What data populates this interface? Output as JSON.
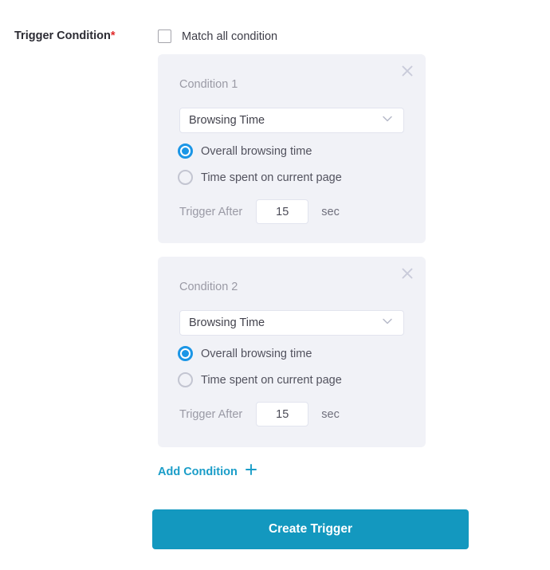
{
  "form": {
    "label": "Trigger Condition",
    "required_marker": "*",
    "match_all": {
      "label": "Match all condition",
      "checked": false
    },
    "conditions": [
      {
        "title": "Condition 1",
        "close_icon": "close-icon",
        "select": {
          "value": "Browsing Time",
          "chevron_icon": "chevron-down-icon"
        },
        "radios": [
          {
            "label": "Overall browsing time",
            "selected": true
          },
          {
            "label": "Time spent on current page",
            "selected": false
          }
        ],
        "trigger_after": {
          "label": "Trigger After",
          "value": "15",
          "unit": "sec"
        }
      },
      {
        "title": "Condition 2",
        "close_icon": "close-icon",
        "select": {
          "value": "Browsing Time",
          "chevron_icon": "chevron-down-icon"
        },
        "radios": [
          {
            "label": "Overall browsing time",
            "selected": true
          },
          {
            "label": "Time spent on current page",
            "selected": false
          }
        ],
        "trigger_after": {
          "label": "Trigger After",
          "value": "15",
          "unit": "sec"
        }
      }
    ],
    "add_condition": {
      "label": "Add Condition",
      "plus_icon": "plus-icon"
    },
    "submit": {
      "label": "Create Trigger"
    }
  },
  "colors": {
    "accent_teal": "#1398bf",
    "link_teal": "#1a9dc8",
    "radio_blue": "#1b96e6",
    "card_bg": "#f1f2f7",
    "required_red": "#e02b2b",
    "muted_text": "#9a9aa5"
  }
}
